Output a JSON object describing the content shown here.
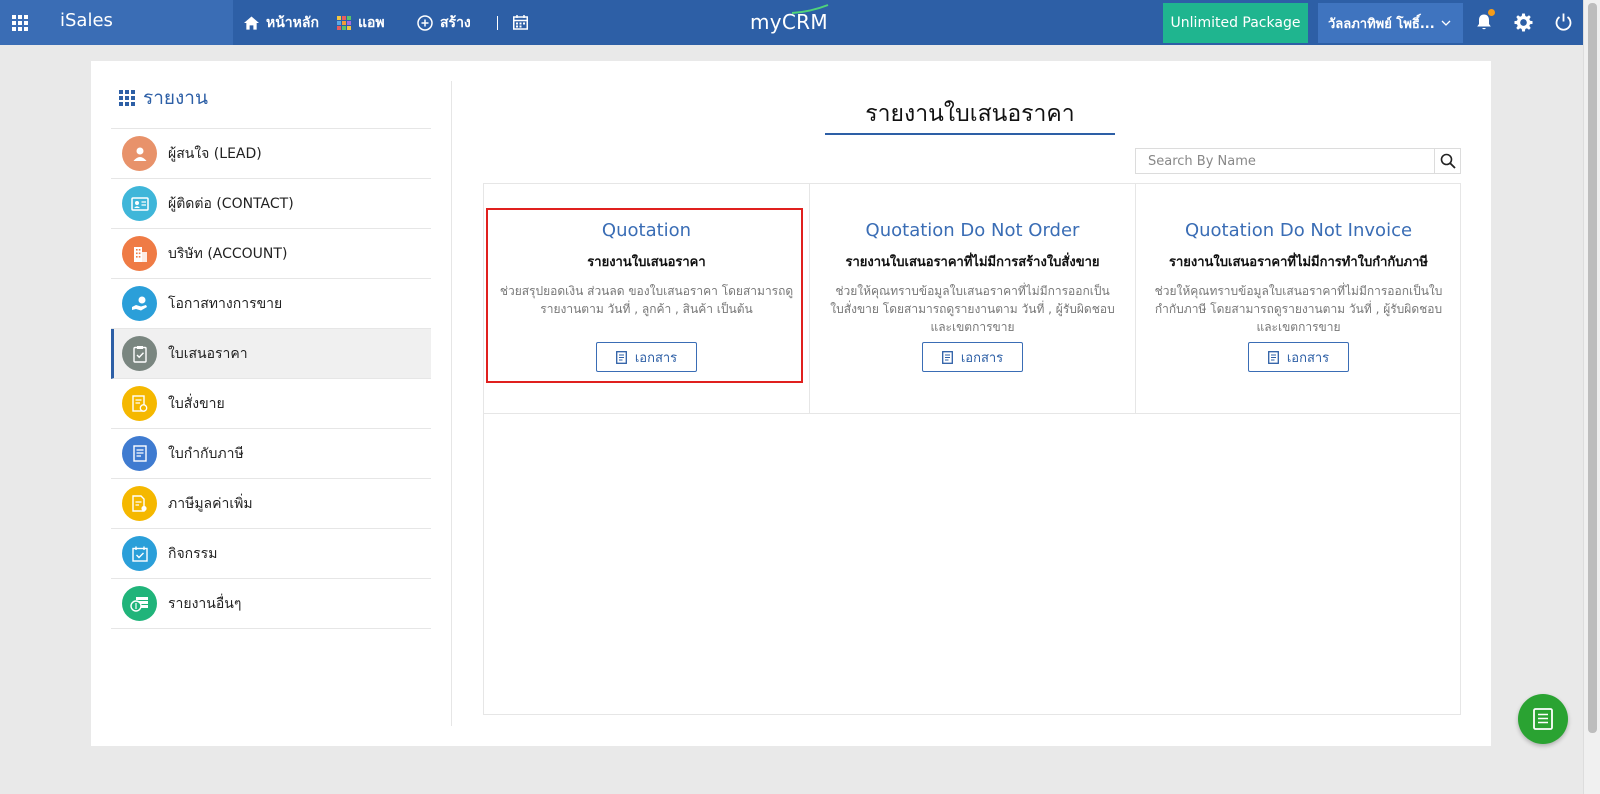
{
  "topbar": {
    "app_name": "iSales",
    "nav": [
      {
        "label": "หน้าหลัก",
        "icon": "home-icon"
      },
      {
        "label": "แอพ",
        "icon": "apps-grid-icon"
      },
      {
        "label": "สร้าง",
        "icon": "plus-circle-icon"
      },
      {
        "label": "",
        "icon": "calendar-icon"
      }
    ],
    "logo": "myCRM",
    "package_label": "Unlimited Package",
    "user_name": "วัลลภาทิพย์ โพธิ์...",
    "colors": {
      "bar": "#2d5fa6",
      "package": "#1fb58f",
      "notification_dot": "#f59c1a"
    }
  },
  "sidebar": {
    "title": "รายงาน",
    "items": [
      {
        "label": "ผู้สนใจ (LEAD)",
        "icon": "person-icon",
        "color": "#e8926a"
      },
      {
        "label": "ผู้ติดต่อ (CONTACT)",
        "icon": "contact-card-icon",
        "color": "#3fb6d9"
      },
      {
        "label": "บริษัท (ACCOUNT)",
        "icon": "building-icon",
        "color": "#ef7b45"
      },
      {
        "label": "โอกาสทางการขาย",
        "icon": "hand-coin-icon",
        "color": "#2b9fd9"
      },
      {
        "label": "ใบเสนอราคา",
        "icon": "clipboard-check-icon",
        "color": "#7a8680",
        "active": true
      },
      {
        "label": "ใบสั่งขาย",
        "icon": "order-icon",
        "color": "#f5b800"
      },
      {
        "label": "ใบกำกับภาษี",
        "icon": "invoice-icon",
        "color": "#3f7bd0"
      },
      {
        "label": "ภาษีมูลค่าเพิ่ม",
        "icon": "tax-doc-icon",
        "color": "#f5b800"
      },
      {
        "label": "กิจกรรม",
        "icon": "calendar-check-icon",
        "color": "#2b9fd9"
      },
      {
        "label": "รายงานอื่นๆ",
        "icon": "money-icon",
        "color": "#20b47a"
      }
    ]
  },
  "content": {
    "title": "รายงานใบเสนอราคา",
    "search_placeholder": "Search By Name",
    "cards": [
      {
        "title": "Quotation",
        "subtitle": "รายงานใบเสนอราคา",
        "description": "ช่วยสรุปยอดเงิน ส่วนลด ของใบเสนอราคา โดยสามารถดูรายงานตาม วันที่ , ลูกค้า , สินค้า เป็นต้น",
        "button": "เอกสาร",
        "highlighted": true
      },
      {
        "title": "Quotation Do Not Order",
        "subtitle": "รายงานใบเสนอราคาที่ไม่มีการสร้างใบสั่งขาย",
        "description": "ช่วยให้คุณทราบข้อมูลใบเสนอราคาที่ไม่มีการออกเป็นใบสั่งขาย โดยสามารถดูรายงานตาม วันที่ , ผู้รับผิดชอบและเขตการขาย",
        "button": "เอกสาร"
      },
      {
        "title": "Quotation Do Not Invoice",
        "subtitle": "รายงานใบเสนอราคาที่ไม่มีการทำใบกำกับภาษี",
        "description": "ช่วยให้คุณทราบข้อมูลใบเสนอราคาที่ไม่มีการออกเป็นใบกำกับภาษี โดยสามารถดูรายงานตาม วันที่ , ผู้รับผิดชอบและเขตการขาย",
        "button": "เอกสาร"
      }
    ]
  },
  "fab": {
    "icon": "notes-icon",
    "color": "#2aa332"
  }
}
